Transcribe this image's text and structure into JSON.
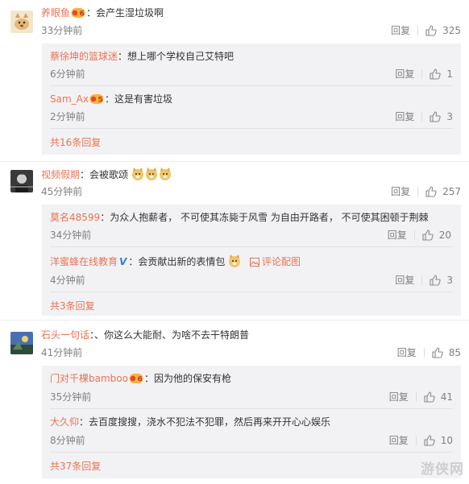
{
  "threads": [
    {
      "author": "养眼鱼",
      "text": "会产生湿垃圾啊",
      "time": "33分钟前",
      "reply": "回复",
      "likes": "325",
      "replies": [
        {
          "author": "蔡徐坤的篮球迷",
          "text": "想上哪个学校自己艾特吧",
          "time": "6分钟前",
          "reply": "回复",
          "likes": "1"
        },
        {
          "author": "Sam_Ax",
          "text": "这是有害垃圾",
          "time": "2分钟前",
          "reply": "回复",
          "likes": "3"
        }
      ],
      "more": "共16条回复"
    },
    {
      "author": "视频假期",
      "text": "会被歌颂",
      "time": "45分钟前",
      "reply": "回复",
      "likes": "257",
      "replies": [
        {
          "author": "莫名48599",
          "text": "为众人抱薪者， 不可使其冻毙于风雪 为自由开路者， 不可使其困顿于荆棘",
          "time": "34分钟前",
          "reply": "回复",
          "likes": "20"
        },
        {
          "author": "洋蜜蜂在线教育",
          "text": "会贡献出新的表情包",
          "pic_link": "评论配图",
          "time": "4分钟前",
          "reply": "回复",
          "likes": "3"
        }
      ],
      "more": "共3条回复"
    },
    {
      "author": "石头一句话",
      "text": "、你这么大能耐、为啥不去干特朗普",
      "time": "41分钟前",
      "reply": "回复",
      "likes": "85",
      "replies": [
        {
          "author": "门对千棵bamboo",
          "text": "因为他的保安有枪",
          "time": "35分钟前",
          "reply": "回复",
          "likes": "41"
        },
        {
          "author": "大久仰",
          "text": "去百度搜搜，浇水不犯法不犯罪，然后再来开开心心娱乐",
          "time": "8分钟前",
          "reply": "回复",
          "likes": "10"
        }
      ],
      "more": "共37条回复"
    }
  ],
  "watermark": "游侠网",
  "colors": {
    "username": "#eb7350",
    "time": "#808080",
    "reply_bg": "#f2f2f5",
    "verified": "#2f7bd9"
  }
}
